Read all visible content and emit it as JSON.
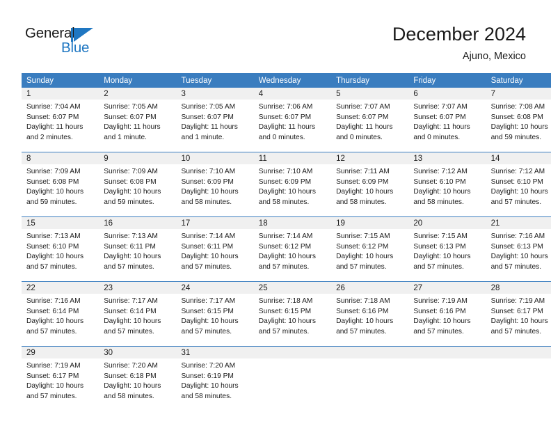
{
  "brand": {
    "name_part1": "General",
    "name_part2": "Blue",
    "accent_color": "#1f77c2"
  },
  "header": {
    "title": "December 2024",
    "subtitle": "Ajuno, Mexico"
  },
  "calendar": {
    "header_bg": "#3a7dbf",
    "daynum_bg": "#f0f0f0",
    "weekdays": [
      "Sunday",
      "Monday",
      "Tuesday",
      "Wednesday",
      "Thursday",
      "Friday",
      "Saturday"
    ],
    "weeks": [
      [
        {
          "day": "1",
          "sunrise": "Sunrise: 7:04 AM",
          "sunset": "Sunset: 6:07 PM",
          "daylight1": "Daylight: 11 hours",
          "daylight2": "and 2 minutes."
        },
        {
          "day": "2",
          "sunrise": "Sunrise: 7:05 AM",
          "sunset": "Sunset: 6:07 PM",
          "daylight1": "Daylight: 11 hours",
          "daylight2": "and 1 minute."
        },
        {
          "day": "3",
          "sunrise": "Sunrise: 7:05 AM",
          "sunset": "Sunset: 6:07 PM",
          "daylight1": "Daylight: 11 hours",
          "daylight2": "and 1 minute."
        },
        {
          "day": "4",
          "sunrise": "Sunrise: 7:06 AM",
          "sunset": "Sunset: 6:07 PM",
          "daylight1": "Daylight: 11 hours",
          "daylight2": "and 0 minutes."
        },
        {
          "day": "5",
          "sunrise": "Sunrise: 7:07 AM",
          "sunset": "Sunset: 6:07 PM",
          "daylight1": "Daylight: 11 hours",
          "daylight2": "and 0 minutes."
        },
        {
          "day": "6",
          "sunrise": "Sunrise: 7:07 AM",
          "sunset": "Sunset: 6:07 PM",
          "daylight1": "Daylight: 11 hours",
          "daylight2": "and 0 minutes."
        },
        {
          "day": "7",
          "sunrise": "Sunrise: 7:08 AM",
          "sunset": "Sunset: 6:08 PM",
          "daylight1": "Daylight: 10 hours",
          "daylight2": "and 59 minutes."
        }
      ],
      [
        {
          "day": "8",
          "sunrise": "Sunrise: 7:09 AM",
          "sunset": "Sunset: 6:08 PM",
          "daylight1": "Daylight: 10 hours",
          "daylight2": "and 59 minutes."
        },
        {
          "day": "9",
          "sunrise": "Sunrise: 7:09 AM",
          "sunset": "Sunset: 6:08 PM",
          "daylight1": "Daylight: 10 hours",
          "daylight2": "and 59 minutes."
        },
        {
          "day": "10",
          "sunrise": "Sunrise: 7:10 AM",
          "sunset": "Sunset: 6:09 PM",
          "daylight1": "Daylight: 10 hours",
          "daylight2": "and 58 minutes."
        },
        {
          "day": "11",
          "sunrise": "Sunrise: 7:10 AM",
          "sunset": "Sunset: 6:09 PM",
          "daylight1": "Daylight: 10 hours",
          "daylight2": "and 58 minutes."
        },
        {
          "day": "12",
          "sunrise": "Sunrise: 7:11 AM",
          "sunset": "Sunset: 6:09 PM",
          "daylight1": "Daylight: 10 hours",
          "daylight2": "and 58 minutes."
        },
        {
          "day": "13",
          "sunrise": "Sunrise: 7:12 AM",
          "sunset": "Sunset: 6:10 PM",
          "daylight1": "Daylight: 10 hours",
          "daylight2": "and 58 minutes."
        },
        {
          "day": "14",
          "sunrise": "Sunrise: 7:12 AM",
          "sunset": "Sunset: 6:10 PM",
          "daylight1": "Daylight: 10 hours",
          "daylight2": "and 57 minutes."
        }
      ],
      [
        {
          "day": "15",
          "sunrise": "Sunrise: 7:13 AM",
          "sunset": "Sunset: 6:10 PM",
          "daylight1": "Daylight: 10 hours",
          "daylight2": "and 57 minutes."
        },
        {
          "day": "16",
          "sunrise": "Sunrise: 7:13 AM",
          "sunset": "Sunset: 6:11 PM",
          "daylight1": "Daylight: 10 hours",
          "daylight2": "and 57 minutes."
        },
        {
          "day": "17",
          "sunrise": "Sunrise: 7:14 AM",
          "sunset": "Sunset: 6:11 PM",
          "daylight1": "Daylight: 10 hours",
          "daylight2": "and 57 minutes."
        },
        {
          "day": "18",
          "sunrise": "Sunrise: 7:14 AM",
          "sunset": "Sunset: 6:12 PM",
          "daylight1": "Daylight: 10 hours",
          "daylight2": "and 57 minutes."
        },
        {
          "day": "19",
          "sunrise": "Sunrise: 7:15 AM",
          "sunset": "Sunset: 6:12 PM",
          "daylight1": "Daylight: 10 hours",
          "daylight2": "and 57 minutes."
        },
        {
          "day": "20",
          "sunrise": "Sunrise: 7:15 AM",
          "sunset": "Sunset: 6:13 PM",
          "daylight1": "Daylight: 10 hours",
          "daylight2": "and 57 minutes."
        },
        {
          "day": "21",
          "sunrise": "Sunrise: 7:16 AM",
          "sunset": "Sunset: 6:13 PM",
          "daylight1": "Daylight: 10 hours",
          "daylight2": "and 57 minutes."
        }
      ],
      [
        {
          "day": "22",
          "sunrise": "Sunrise: 7:16 AM",
          "sunset": "Sunset: 6:14 PM",
          "daylight1": "Daylight: 10 hours",
          "daylight2": "and 57 minutes."
        },
        {
          "day": "23",
          "sunrise": "Sunrise: 7:17 AM",
          "sunset": "Sunset: 6:14 PM",
          "daylight1": "Daylight: 10 hours",
          "daylight2": "and 57 minutes."
        },
        {
          "day": "24",
          "sunrise": "Sunrise: 7:17 AM",
          "sunset": "Sunset: 6:15 PM",
          "daylight1": "Daylight: 10 hours",
          "daylight2": "and 57 minutes."
        },
        {
          "day": "25",
          "sunrise": "Sunrise: 7:18 AM",
          "sunset": "Sunset: 6:15 PM",
          "daylight1": "Daylight: 10 hours",
          "daylight2": "and 57 minutes."
        },
        {
          "day": "26",
          "sunrise": "Sunrise: 7:18 AM",
          "sunset": "Sunset: 6:16 PM",
          "daylight1": "Daylight: 10 hours",
          "daylight2": "and 57 minutes."
        },
        {
          "day": "27",
          "sunrise": "Sunrise: 7:19 AM",
          "sunset": "Sunset: 6:16 PM",
          "daylight1": "Daylight: 10 hours",
          "daylight2": "and 57 minutes."
        },
        {
          "day": "28",
          "sunrise": "Sunrise: 7:19 AM",
          "sunset": "Sunset: 6:17 PM",
          "daylight1": "Daylight: 10 hours",
          "daylight2": "and 57 minutes."
        }
      ],
      [
        {
          "day": "29",
          "sunrise": "Sunrise: 7:19 AM",
          "sunset": "Sunset: 6:17 PM",
          "daylight1": "Daylight: 10 hours",
          "daylight2": "and 57 minutes."
        },
        {
          "day": "30",
          "sunrise": "Sunrise: 7:20 AM",
          "sunset": "Sunset: 6:18 PM",
          "daylight1": "Daylight: 10 hours",
          "daylight2": "and 58 minutes."
        },
        {
          "day": "31",
          "sunrise": "Sunrise: 7:20 AM",
          "sunset": "Sunset: 6:19 PM",
          "daylight1": "Daylight: 10 hours",
          "daylight2": "and 58 minutes."
        },
        {
          "day": "",
          "sunrise": "",
          "sunset": "",
          "daylight1": "",
          "daylight2": ""
        },
        {
          "day": "",
          "sunrise": "",
          "sunset": "",
          "daylight1": "",
          "daylight2": ""
        },
        {
          "day": "",
          "sunrise": "",
          "sunset": "",
          "daylight1": "",
          "daylight2": ""
        },
        {
          "day": "",
          "sunrise": "",
          "sunset": "",
          "daylight1": "",
          "daylight2": ""
        }
      ]
    ]
  }
}
